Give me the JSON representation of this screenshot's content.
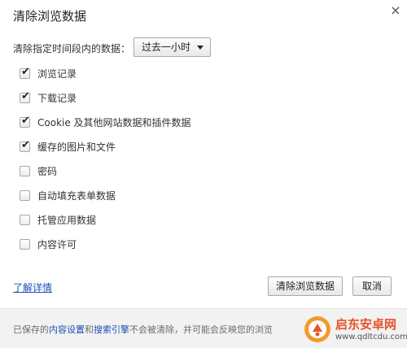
{
  "dialog": {
    "title": "清除浏览数据",
    "close_glyph": "×"
  },
  "time_range": {
    "label": "清除指定时间段内的数据：",
    "selected": "过去一小时"
  },
  "options": [
    {
      "label": "浏览记录",
      "checked": true
    },
    {
      "label": "下载记录",
      "checked": true
    },
    {
      "label": "Cookie 及其他网站数据和插件数据",
      "checked": true
    },
    {
      "label": "缓存的图片和文件",
      "checked": true
    },
    {
      "label": "密码",
      "checked": false
    },
    {
      "label": "自动填充表单数据",
      "checked": false
    },
    {
      "label": "托管应用数据",
      "checked": false
    },
    {
      "label": "内容许可",
      "checked": false
    }
  ],
  "learn_more": "了解详情",
  "buttons": {
    "clear": "清除浏览数据",
    "cancel": "取消"
  },
  "footer": {
    "prefix": "已保存的",
    "link1": "内容设置",
    "and": "和",
    "link2": "搜索引擎",
    "suffix": "不会被清除，并可能会反映您的浏览"
  },
  "watermark": {
    "name": "启东安卓网",
    "url": "www.qdltcdu.com"
  },
  "colors": {
    "link": "#1a4fb5",
    "footer_bg": "#f2f2f2",
    "watermark": "#e8532a"
  }
}
